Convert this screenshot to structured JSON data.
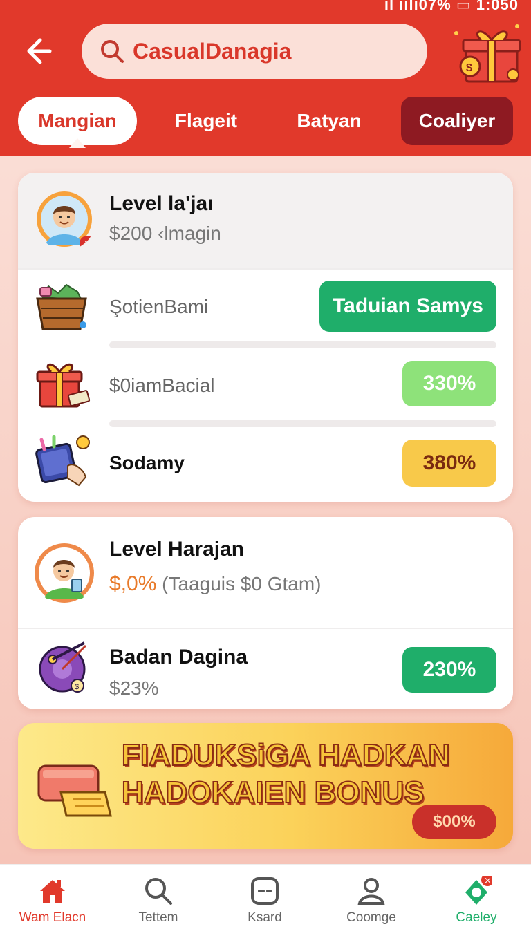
{
  "status": {
    "text": "ıl ıılı07% ▭ 1:050"
  },
  "search": {
    "text": "CasualDanagia"
  },
  "tabs": [
    {
      "label": "Mangian"
    },
    {
      "label": "Flageit"
    },
    {
      "label": "Batyan"
    },
    {
      "label": "Coaliyer"
    }
  ],
  "card1": {
    "title": "Level la'jaı",
    "subtitle": "$200 ‹lmagin",
    "rows": [
      {
        "label": "ŞotienBami",
        "button": "Taduian Samys",
        "color": "#1fae6a"
      },
      {
        "label": "$0iamBacial",
        "value": "330%",
        "color": "#8ee27a"
      },
      {
        "label": "Sodamy",
        "value": "380%",
        "color": "#f8c94a"
      }
    ]
  },
  "card2": {
    "title": "Level Harajan",
    "subtitle_highlight": "$,0%",
    "subtitle_rest": "(Taaguis $0 Gtam)",
    "row_title": "Badan Dagina",
    "row_sub": "$23%",
    "row_value": "230%",
    "row_color": "#1fae6a"
  },
  "banner": {
    "line1": "FIADUKSiGA HADKAN",
    "line2": "HADOKAIEN BONUS",
    "pill": "$00%"
  },
  "nav": [
    {
      "label": "Wam Elacn",
      "icon": "home-icon",
      "active": true
    },
    {
      "label": "Tettem",
      "icon": "search-icon"
    },
    {
      "label": "Ksard",
      "icon": "chat-icon"
    },
    {
      "label": "Coomge",
      "icon": "profile-icon"
    },
    {
      "label": "Caeley",
      "icon": "gift-icon",
      "badge": "×"
    }
  ],
  "colors": {
    "accent": "#e1392b",
    "dark_tab": "#8e1a22",
    "green": "#1fae6a"
  }
}
